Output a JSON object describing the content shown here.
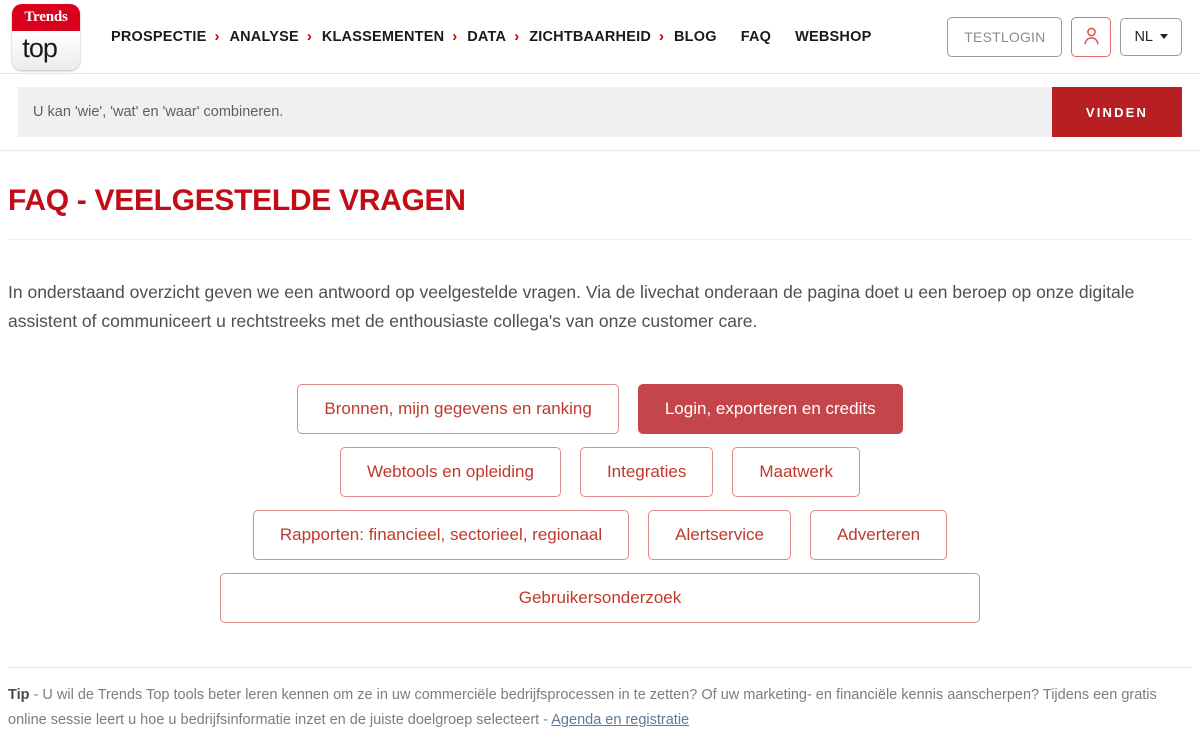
{
  "header": {
    "logo": {
      "top_text": "Trends",
      "bottom_text": "top",
      "icon": "magnifier-icon"
    },
    "nav_items": [
      {
        "label": "PROSPECTIE",
        "has_chevron": true
      },
      {
        "label": "ANALYSE",
        "has_chevron": true
      },
      {
        "label": "KLASSEMENTEN",
        "has_chevron": true
      },
      {
        "label": "DATA",
        "has_chevron": true
      },
      {
        "label": "ZICHTBAARHEID",
        "has_chevron": true
      },
      {
        "label": "BLOG",
        "has_chevron": false
      },
      {
        "label": "FAQ",
        "has_chevron": false
      },
      {
        "label": "WEBSHOP",
        "has_chevron": false
      }
    ],
    "chevron_glyph": "›",
    "testlogin_label": "TESTLOGIN",
    "account_icon": "user-icon",
    "language_label": "NL"
  },
  "search": {
    "placeholder": "U kan 'wie', 'wat' en 'waar' combineren.",
    "value": "",
    "button_label": "VINDEN"
  },
  "page": {
    "title": "FAQ - VEELGESTELDE VRAGEN",
    "intro": "In onderstaand overzicht geven we een antwoord op veelgestelde vragen. Via de livechat onderaan de pagina doet u een beroep op onze digitale assistent of communiceert u rechtstreeks met de enthousiaste collega's van onze customer care."
  },
  "categories": {
    "rows": [
      [
        {
          "label": "Bronnen, mijn gegevens en ranking",
          "active": false
        },
        {
          "label": "Login, exporteren en credits",
          "active": true
        }
      ],
      [
        {
          "label": "Webtools en opleiding",
          "active": false
        },
        {
          "label": "Integraties",
          "active": false
        },
        {
          "label": "Maatwerk",
          "active": false
        }
      ],
      [
        {
          "label": "Rapporten: financieel, sectorieel, regionaal",
          "active": false
        },
        {
          "label": "Alertservice",
          "active": false
        },
        {
          "label": "Adverteren",
          "active": false
        }
      ],
      [
        {
          "label": "Gebruikersonderzoek",
          "active": false
        }
      ]
    ]
  },
  "tip": {
    "prefix": "Tip",
    "body": " - U wil de Trends Top tools beter leren kennen om ze in uw commerciële bedrijfsprocessen in te zetten? Of uw marketing- en financiële kennis aanscherpen? Tijdens een gratis online sessie leert u hoe u bedrijfsinformatie inzet en de juiste doelgroep selecteert - ",
    "link_label": "Agenda en registratie"
  },
  "colors": {
    "brand_red": "#c00d16",
    "logo_red": "#d8001c",
    "search_button_red": "#b81f22",
    "active_button_red": "#c5464a",
    "category_text_red": "#c0392b",
    "link_blue": "#5c7a99"
  }
}
